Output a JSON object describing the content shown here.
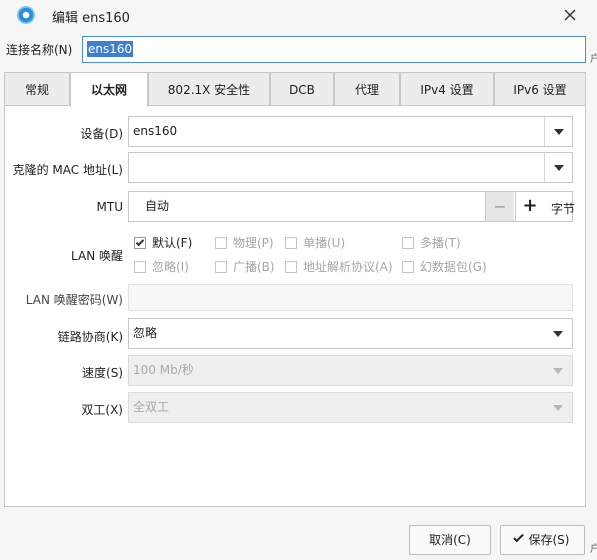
{
  "window": {
    "title": "编辑 ens160"
  },
  "connection_name": {
    "label": "连接名称(N)",
    "value": "ens160"
  },
  "tabs": [
    {
      "label": "常规"
    },
    {
      "label": "以太网"
    },
    {
      "label": "802.1X 安全性"
    },
    {
      "label": "DCB"
    },
    {
      "label": "代理"
    },
    {
      "label": "IPv4 设置"
    },
    {
      "label": "IPv6 设置"
    }
  ],
  "active_tab": "以太网",
  "ethernet": {
    "device": {
      "label": "设备(D)",
      "value": "ens160"
    },
    "cloned_mac": {
      "label": "克隆的 MAC 地址(L)",
      "value": ""
    },
    "mtu": {
      "label": "MTU",
      "value": "自动",
      "minus": "−",
      "plus": "+",
      "unit": "字节"
    },
    "wake_on_lan": {
      "label": "LAN 唤醒",
      "options": [
        {
          "label": "默认(F)",
          "checked": true,
          "enabled": true
        },
        {
          "label": "物理(P)",
          "checked": false,
          "enabled": false
        },
        {
          "label": "单播(U)",
          "checked": false,
          "enabled": false
        },
        {
          "label": "多播(T)",
          "checked": false,
          "enabled": false
        },
        {
          "label": "忽略(I)",
          "checked": false,
          "enabled": false
        },
        {
          "label": "广播(B)",
          "checked": false,
          "enabled": false
        },
        {
          "label": "地址解析协议(A)",
          "checked": false,
          "enabled": false
        },
        {
          "label": "幻数据包(G)",
          "checked": false,
          "enabled": false
        }
      ]
    },
    "wol_password": {
      "label": "LAN 唤醒密码(W)",
      "value": ""
    },
    "link_negotiation": {
      "label": "链路协商(K)",
      "value": "忽略"
    },
    "speed": {
      "label": "速度(S)",
      "value": "100 Mb/秒"
    },
    "duplex": {
      "label": "双工(X)",
      "value": "全双工"
    }
  },
  "buttons": {
    "cancel": "取消(C)",
    "save": "保存(S)"
  },
  "edge_fragments": {
    "top": "户",
    "bottom": "户"
  },
  "colors": {
    "accent": "#4a90d9",
    "selection": "#3f7fd2"
  }
}
